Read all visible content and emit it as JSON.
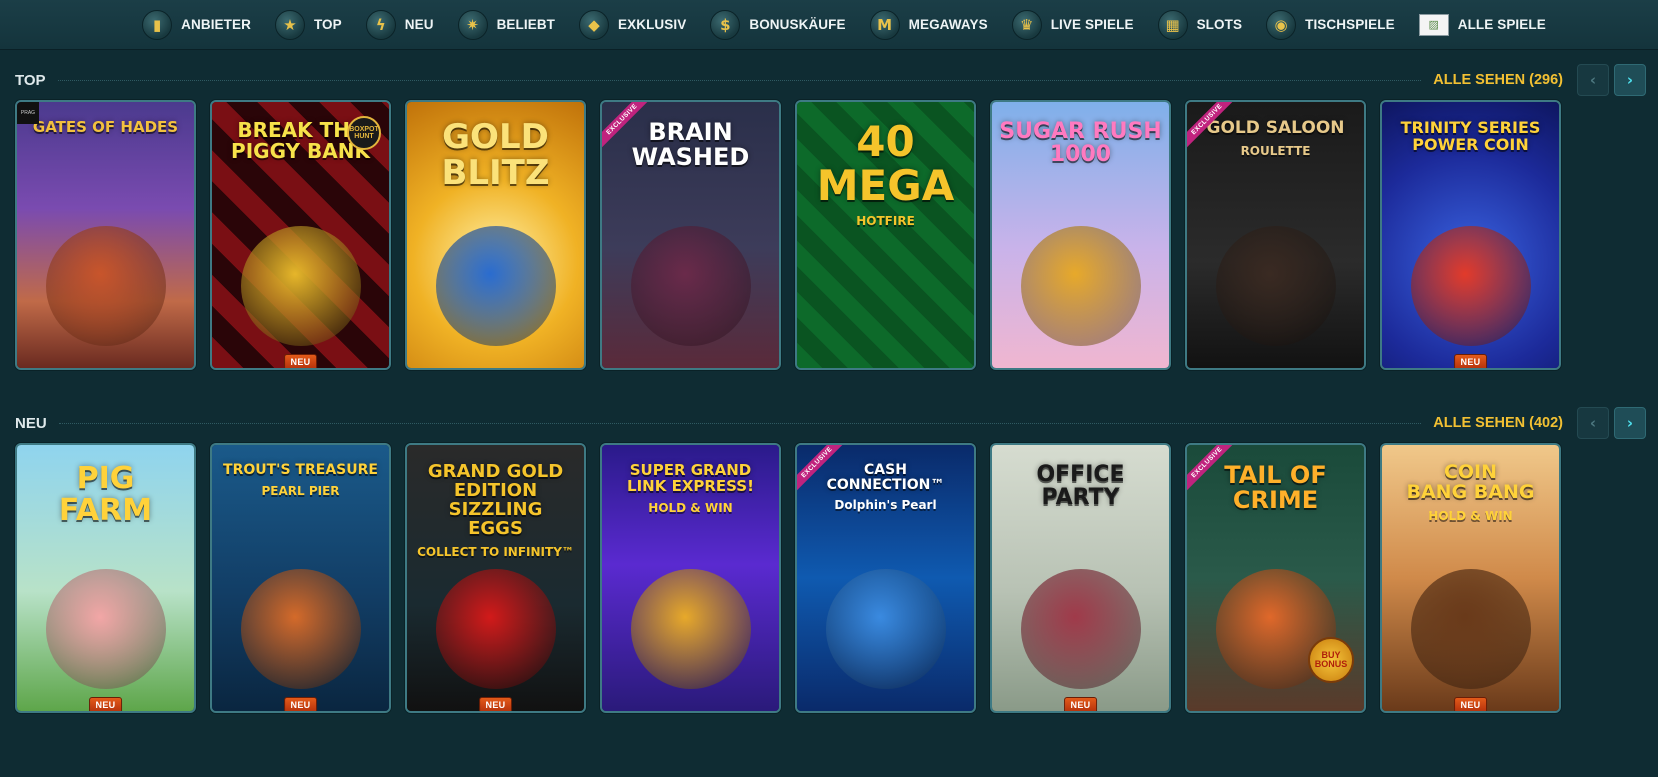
{
  "nav": {
    "items": [
      {
        "label": "ANBIETER",
        "icon": "provider-icon",
        "glyph": "▮"
      },
      {
        "label": "TOP",
        "icon": "star-icon",
        "glyph": "★"
      },
      {
        "label": "NEU",
        "icon": "lightning-icon",
        "glyph": "ϟ"
      },
      {
        "label": "BELIEBT",
        "icon": "badge-icon",
        "glyph": "✷"
      },
      {
        "label": "EXKLUSIV",
        "icon": "diamond-icon",
        "glyph": "◆"
      },
      {
        "label": "BONUSKÄUFE",
        "icon": "money-bag-icon",
        "glyph": "$"
      },
      {
        "label": "MEGAWAYS",
        "icon": "megaways-icon",
        "glyph": "M"
      },
      {
        "label": "LIVE SPIELE",
        "icon": "trophy-icon",
        "glyph": "♛"
      },
      {
        "label": "SLOTS",
        "icon": "slot-machine-icon",
        "glyph": "▦"
      },
      {
        "label": "TISCHSPIELE",
        "icon": "table-icon",
        "glyph": "◉"
      },
      {
        "label": "ALLE SPIELE",
        "icon": "broken-image-icon",
        "glyph": "▨"
      }
    ]
  },
  "rows": [
    {
      "title": "TOP",
      "see_all": "ALLE SEHEN (296)",
      "games": [
        {
          "title": "Gates of Hades",
          "sub": "",
          "bg": "linear-gradient(180deg,#4b3a8e 0%,#7a4bb0 40%,#c06a48 75%,#6a2a20 100%)",
          "color": "#f3c13e",
          "size": 15,
          "figure": "#c8552b",
          "new": false,
          "exclusive": false,
          "corner": "dark"
        },
        {
          "title": "BREAK the\nPIGGY BANK",
          "sub": "",
          "bg": "repeating-linear-gradient(45deg,#7a0f14 0 22px,#2a0508 22px 44px)",
          "color": "#f7e24a",
          "size": 20,
          "figure": "#e6b62a",
          "new": true,
          "exclusive": false,
          "corner": "logo"
        },
        {
          "title": "GOLD\nBLITZ",
          "sub": "",
          "bg": "radial-gradient(circle at 50% 60%,#fff1a8 0%,#f0b225 45%,#c0720a 100%)",
          "color": "#fbe27a",
          "size": 34,
          "figure": "#2a6ccf",
          "new": false,
          "exclusive": false,
          "corner": ""
        },
        {
          "title": "BRAIN\nWASHED",
          "sub": "",
          "bg": "linear-gradient(180deg,#2a2f4a 0%,#3d3c5a 55%,#5a2a3a 100%)",
          "color": "#ffffff",
          "size": 24,
          "figure": "#6a2a4a",
          "new": false,
          "exclusive": true,
          "corner": ""
        },
        {
          "title": "40\nMEGA",
          "sub": "HOTFIRE",
          "bg": "repeating-linear-gradient(45deg,#0d6a2a 0 18px,#0a5421 18px 36px)",
          "color": "#f5c42b",
          "size": 42,
          "figure": "",
          "new": false,
          "exclusive": false,
          "corner": ""
        },
        {
          "title": "Sugar RUSH\n1000",
          "sub": "",
          "bg": "linear-gradient(180deg,#7fb0ea 0%,#c9b3ea 55%,#f0b6d0 100%)",
          "color": "#ff7ac0",
          "size": 22,
          "figure": "#e7a92a",
          "new": false,
          "exclusive": false,
          "corner": ""
        },
        {
          "title": "GOLD SALOON",
          "sub": "ROULETTE",
          "bg": "linear-gradient(180deg,#1a1a1a 0%,#2b2b2b 60%,#121212 100%)",
          "color": "#e7c98a",
          "size": 17,
          "figure": "#3a2a22",
          "new": false,
          "exclusive": true,
          "corner": ""
        },
        {
          "title": "TRINITY SERIES\nPOWER COIN",
          "sub": "",
          "bg": "radial-gradient(circle at 50% 60%,#3a63e0 0%,#1c2a9a 60%,#0e1660 100%)",
          "color": "#ffd23a",
          "size": 16,
          "figure": "#e23a2a",
          "new": true,
          "exclusive": false,
          "corner": ""
        }
      ]
    },
    {
      "title": "NEU",
      "see_all": "ALLE SEHEN (402)",
      "games": [
        {
          "title": "PIG\nFARM",
          "sub": "",
          "bg": "linear-gradient(180deg,#8fd4ee 0%,#b8e2c8 55%,#5ea64a 100%)",
          "color": "#ffd23a",
          "size": 30,
          "figure": "#f2a6a6",
          "new": true,
          "exclusive": false,
          "corner": ""
        },
        {
          "title": "TROUT'S TREASURE",
          "sub": "PEARL PIER",
          "bg": "linear-gradient(180deg,#1a5a8a 0%,#123e66 55%,#0a2640 100%)",
          "color": "#ffd23a",
          "size": 14,
          "figure": "#d46a2a",
          "new": true,
          "exclusive": false,
          "corner": ""
        },
        {
          "title": "GRAND GOLD EDITION\nSIZZLING\nEGGS",
          "sub": "COLLECT TO INFINITY™",
          "bg": "linear-gradient(180deg,#2a2a2a 0%,#1a2a30 60%,#111 100%)",
          "color": "#f5c42b",
          "size": 18,
          "figure": "#d21a1a",
          "new": true,
          "exclusive": false,
          "corner": ""
        },
        {
          "title": "SUPER GRAND\nLINK EXPRESS!",
          "sub": "HOLD & WIN",
          "bg": "linear-gradient(180deg,#2a1a8a 0%,#5a2ad0 45%,#2a1a7a 100%)",
          "color": "#ffd23a",
          "size": 15,
          "figure": "#e7a92a",
          "new": false,
          "exclusive": false,
          "corner": ""
        },
        {
          "title": "CASH CONNECTION™",
          "sub": "Dolphin's Pearl",
          "bg": "linear-gradient(180deg,#0a2a6a 0%,#0f5ab0 50%,#0a2a6a 100%)",
          "color": "#ffffff",
          "size": 14,
          "figure": "#3a8ae0",
          "new": false,
          "exclusive": true,
          "corner": ""
        },
        {
          "title": "OFFICE\nPARTY",
          "sub": "",
          "bg": "linear-gradient(180deg,#d6dcd0 0%,#b8c2b4 55%,#8a9a88 100%)",
          "color": "#1a1a1a",
          "size": 22,
          "figure": "#a03a4a",
          "new": true,
          "exclusive": false,
          "corner": ""
        },
        {
          "title": "TAIL OF\nCRIME",
          "sub": "",
          "bg": "linear-gradient(180deg,#1a4a3a 0%,#2a5a4a 50%,#5a3a2a 100%)",
          "color": "#ffb02a",
          "size": 24,
          "figure": "#e0682a",
          "new": false,
          "exclusive": true,
          "corner": "chip"
        },
        {
          "title": "COIN\nBANG BANG",
          "sub": "HOLD & WIN",
          "bg": "linear-gradient(180deg,#f0c88a 0%,#d08a4a 50%,#6a3a1a 100%)",
          "color": "#ffd23a",
          "size": 19,
          "figure": "#6a3a1a",
          "new": true,
          "exclusive": false,
          "corner": ""
        }
      ]
    }
  ],
  "labels": {
    "new_badge": "NEU",
    "exclusive_ribbon": "EXCLUSIVE",
    "logo_badge": "BOXPOT HUNT",
    "dark_badge": "PRAG",
    "chip_badge": "BUY BONUS",
    "prev_arrow": "‹",
    "next_arrow": "›"
  }
}
